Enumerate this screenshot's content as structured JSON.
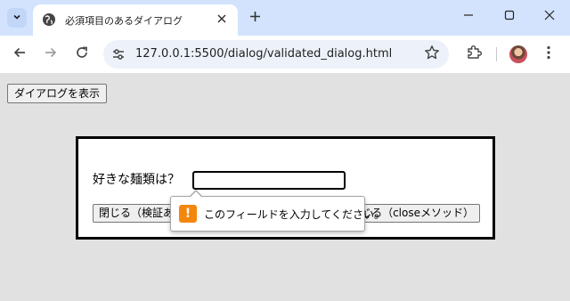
{
  "browser": {
    "tab": {
      "title": "必須項目のあるダイアログ"
    },
    "address_bar": {
      "url": "127.0.0.1:5500/dialog/validated_dialog.html"
    },
    "icons": {
      "tab_search": "chevron-down-icon",
      "favicon": "globe-icon",
      "tab_close": "close-icon",
      "new_tab": "plus-icon",
      "minimize": "minimize-icon",
      "maximize": "maximize-icon",
      "close_window": "close-icon",
      "back": "arrow-left-icon",
      "forward": "arrow-right-icon",
      "reload": "reload-icon",
      "site_info": "tune-icon",
      "bookmark": "star-icon",
      "extensions": "puzzle-icon",
      "menu": "kebab-menu-icon"
    },
    "colors": {
      "tabstrip": "#d3e3fd",
      "omnibox": "#edf2fa",
      "page_bg": "#e1e1e1",
      "warning": "#f5860c"
    }
  },
  "page": {
    "show_dialog_button": "ダイアログを表示",
    "dialog": {
      "question_label": "好きな麺類は？",
      "input_value": "",
      "close_validate_button": "閉じる（検証あり）",
      "close_method_button": "閉じる（closeメソッド）"
    },
    "validation_tooltip": {
      "icon": "!",
      "message": "このフィールドを入力してください。"
    }
  }
}
